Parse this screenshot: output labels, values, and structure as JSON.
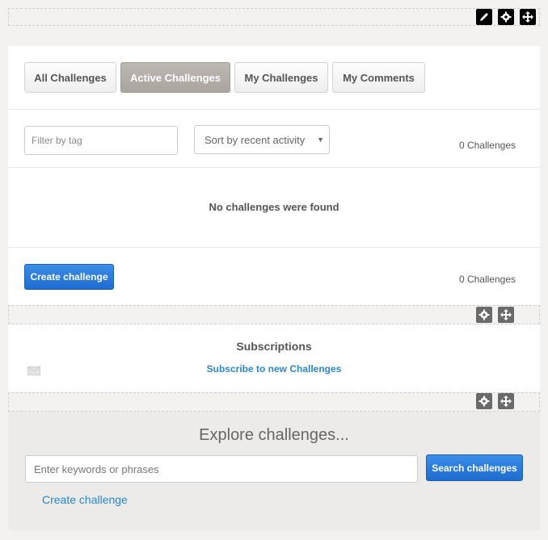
{
  "tabs": [
    {
      "label": "All Challenges",
      "active": false
    },
    {
      "label": "Active Challenges",
      "active": true
    },
    {
      "label": "My Challenges",
      "active": false
    },
    {
      "label": "My Comments",
      "active": false
    }
  ],
  "filter": {
    "placeholder": "Filter by tag"
  },
  "sort": {
    "selected": "Sort by recent activity"
  },
  "counts": {
    "top": "0 Challenges",
    "bottom": "0 Challenges"
  },
  "empty_message": "No challenges were found",
  "create_button_label": "Create challenge",
  "subscriptions": {
    "title": "Subscriptions",
    "link": "Subscribe to new Challenges"
  },
  "explore": {
    "title": "Explore challenges...",
    "input_placeholder": "Enter keywords or phrases",
    "search_button": "Search challenges",
    "create_link": "Create challenge"
  },
  "icons": [
    "edit-icon",
    "gear-icon",
    "move-icon",
    "mail-icon",
    "dropdown-caret-icon"
  ],
  "colors": {
    "primary": "#1f6cce",
    "link": "#2b87c8",
    "active_tab": "#b3aea8"
  }
}
